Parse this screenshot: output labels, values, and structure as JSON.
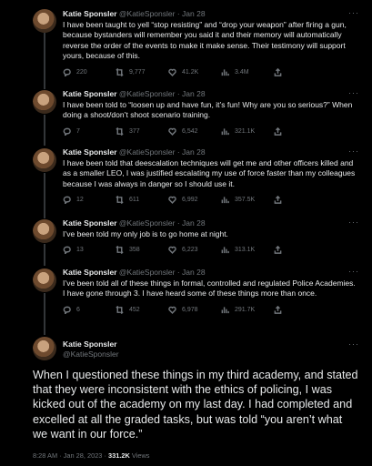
{
  "author": {
    "name": "Katie Sponsler",
    "handle": "@KatieSponsler"
  },
  "more_label": "···",
  "tweets": [
    {
      "date": "· Jan 28",
      "text": "I have been taught to yell “stop resisting” and “drop your weapon” after firing a gun, because bystanders will remember you said it and their memory will automatically reverse the order of the events to make it make sense. Their testimony will support yours, because of this.",
      "replies": "220",
      "retweets": "9,777",
      "likes": "41.2K",
      "views": "3.4M"
    },
    {
      "date": "· Jan 28",
      "text": "I have been told to “loosen up and have fun, it’s fun! Why are you so serious?” When doing a shoot/don’t shoot scenario training.",
      "replies": "7",
      "retweets": "377",
      "likes": "6,542",
      "views": "321.1K"
    },
    {
      "date": "· Jan 28",
      "text": "I have been told that deescalation techniques will get me and other officers killed and as a smaller LEO, I was justified escalating my use of force faster than my colleagues because I was always in danger so I should use it.",
      "replies": "12",
      "retweets": "611",
      "likes": "6,992",
      "views": "357.5K"
    },
    {
      "date": "· Jan 28",
      "text": "I’ve been told my only job is to go home at night.",
      "replies": "13",
      "retweets": "358",
      "likes": "6,223",
      "views": "313.1K"
    },
    {
      "date": "· Jan 28",
      "text": "I’ve been told all of these things in formal, controlled and regulated Police Academies. I have gone through 3. I have heard some of these things more than once.",
      "replies": "6",
      "retweets": "452",
      "likes": "6,978",
      "views": "291.7K"
    }
  ],
  "final": {
    "text": "When I questioned these things in my third academy, and stated that they were inconsistent with the ethics of policing, I was kicked out of the academy on my last day. I had completed and excelled at all the graded tasks, but was told “you aren’t what we want in our force.”",
    "timestamp": "8:28 AM · Jan 28, 2023 · ",
    "views": "331.2K",
    "views_label": "Views"
  }
}
